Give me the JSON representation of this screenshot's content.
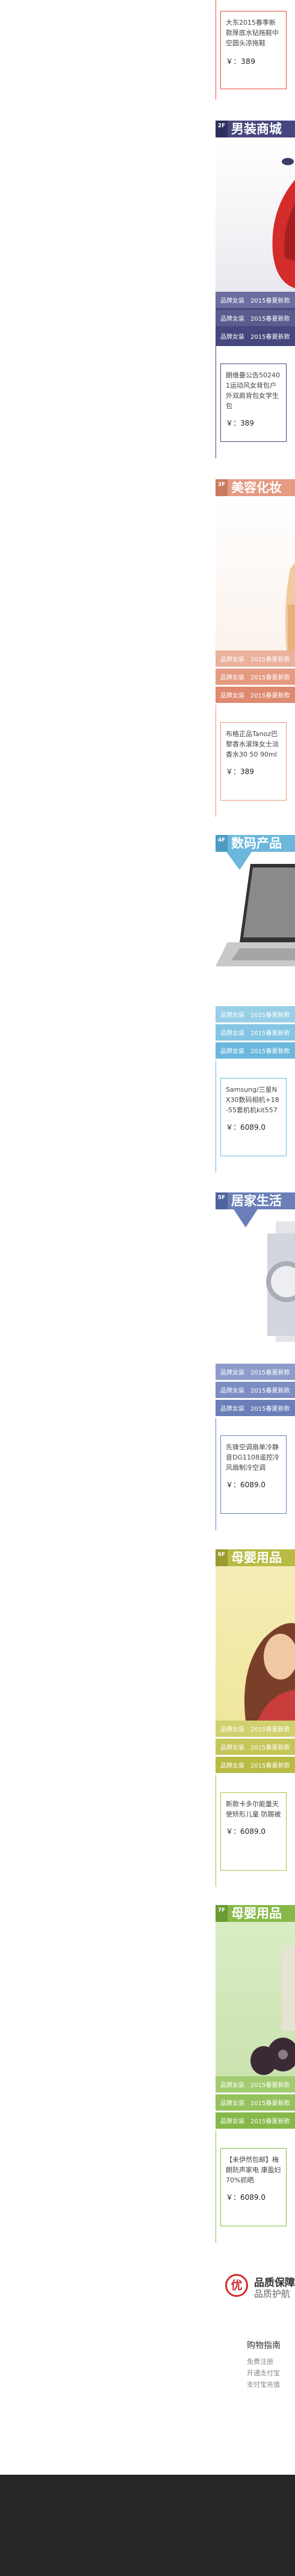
{
  "colors": {
    "red": "#e24e3c",
    "navy": "#46477e",
    "salmon": "#e59a82",
    "sky": "#6cb8dd",
    "steel": "#6a7fb8",
    "olive": "#b9bb44",
    "green": "#87b94a",
    "footer": "#272727"
  },
  "top_card": {
    "desc": "大东2015春季新款厚底水钻拖鞋中空圆头凉拖鞋",
    "price": "￥：389"
  },
  "sections": [
    {
      "num": "2F",
      "title": "男装商城",
      "rows": [
        {
          "label": "品牌女装",
          "value": "2015春夏新款"
        },
        {
          "label": "品牌女装",
          "value": "2015春夏新款"
        },
        {
          "label": "品牌女装",
          "value": "2015春夏新款"
        }
      ],
      "product": {
        "desc": "朗维曼公告502401运动风女背包户外双肩背包女学生包",
        "price": "￥：389"
      }
    },
    {
      "num": "3F",
      "title": "美容化妆",
      "rows": [
        {
          "label": "品牌女装",
          "value": "2015春夏新款"
        },
        {
          "label": "品牌女装",
          "value": "2015春夏新款"
        },
        {
          "label": "品牌女装",
          "value": "2015春夏新款"
        }
      ],
      "product": {
        "desc": "布格正品Tanoz巴黎香水滚珠女士淡香水30 50 90ml",
        "price": "￥：389"
      }
    },
    {
      "num": "4F",
      "title": "数码产品",
      "rows": [
        {
          "label": "品牌女装",
          "value": "2015春夏新款"
        },
        {
          "label": "品牌女装",
          "value": "2015春夏新款"
        },
        {
          "label": "品牌女装",
          "value": "2015春夏新款"
        }
      ],
      "product": {
        "desc": "Samsung/三星NX30数码相机+18-55套机机kit557",
        "price": "￥：6089.0"
      }
    },
    {
      "num": "5F",
      "title": "居家生活",
      "rows": [
        {
          "label": "品牌女装",
          "value": "2015春夏新款"
        },
        {
          "label": "品牌女装",
          "value": "2015春夏新款"
        },
        {
          "label": "品牌女装",
          "value": "2015春夏新款"
        }
      ],
      "product": {
        "desc": "先锋空调扇单冷静音DG1108遥控冷风扇制冷空调",
        "price": "￥：6089.0"
      }
    },
    {
      "num": "6F",
      "title": "母婴用品",
      "rows": [
        {
          "label": "品牌女装",
          "value": "2015春夏新款"
        },
        {
          "label": "品牌女装",
          "value": "2015春夏新款"
        },
        {
          "label": "品牌女装",
          "value": "2015春夏新款"
        }
      ],
      "product": {
        "desc": "新款卡多尔能量天使矫形儿童 防踢被",
        "price": "￥：6089.0"
      }
    },
    {
      "num": "7F",
      "title": "母婴用品",
      "rows": [
        {
          "label": "品牌女装",
          "value": "2015春夏新款"
        },
        {
          "label": "品牌女装",
          "value": "2015春夏新款"
        },
        {
          "label": "品牌女装",
          "value": "2015春夏新款"
        }
      ],
      "product": {
        "desc": "【未伊然包邮】梅朗防声家电 康盈妇70%抓晒",
        "price": "￥：6089.0"
      }
    }
  ],
  "guarantee": {
    "badge": "优",
    "title": "品质保障",
    "subtitle": "品质护航"
  },
  "guide": {
    "title": "购物指南",
    "items": [
      "免费注册",
      "开通支付宝",
      "支付宝充值"
    ]
  }
}
